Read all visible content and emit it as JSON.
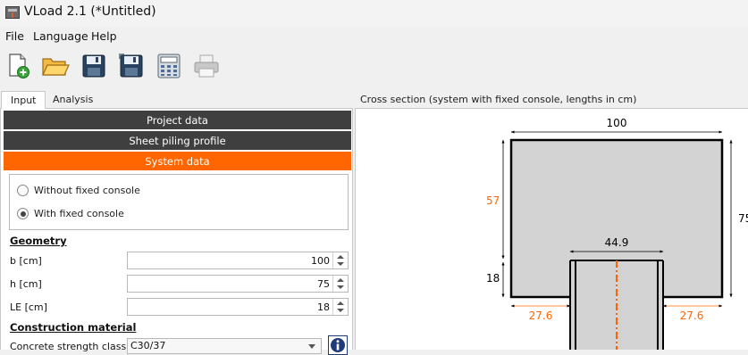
{
  "window": {
    "title": "VLoad 2.1 (*Untitled)"
  },
  "menu": {
    "file": "File",
    "language": "Language",
    "help": "Help"
  },
  "toolbar": {
    "buttons": [
      "new-file-icon",
      "open-folder-icon",
      "save-icon",
      "save-as-icon",
      "calculator-icon",
      "print-icon"
    ]
  },
  "tabs": {
    "input": "Input",
    "analysis": "Analysis"
  },
  "sections": {
    "project": "Project data",
    "profile": "Sheet piling profile",
    "system": "System data"
  },
  "system": {
    "option_without": "Without fixed console",
    "option_with": "With fixed console",
    "selected": "With fixed console"
  },
  "geometry": {
    "heading": "Geometry",
    "b_label": "b [cm]",
    "b_value": "100",
    "h_label": "h [cm]",
    "h_value": "75",
    "le_label": "LE [cm]",
    "le_value": "18"
  },
  "material": {
    "heading": "Construction material",
    "concrete_label": "Concrete strength class",
    "concrete_value": "C30/37"
  },
  "cross_section": {
    "title": "Cross section (system with fixed console, lengths in cm)",
    "dim_width": "100",
    "dim_height": "75",
    "dim_top": "57",
    "dim_bottom": "18",
    "dim_inner": "44.9",
    "dim_left": "27.6",
    "dim_right": "27.6"
  },
  "colors": {
    "accent": "#ff6600",
    "section_bar": "#3f3f3f",
    "concrete_fill": "#d3d3d3"
  }
}
